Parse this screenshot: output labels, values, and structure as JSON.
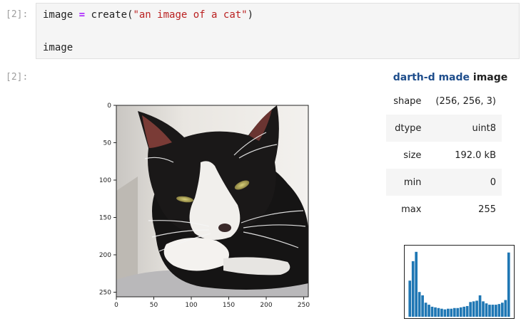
{
  "input_cell": {
    "prompt": "[2]:",
    "line1": {
      "var": "image ",
      "op": "=",
      "func": " create(",
      "str": "\"an image of a cat\"",
      "close": ")"
    },
    "line2": "image"
  },
  "output_cell": {
    "prompt": "[2]:",
    "title_pkg": "darth-d made",
    "title_rest": " image",
    "info_rows": [
      {
        "key": "shape",
        "value": "(256, 256, 3)"
      },
      {
        "key": "dtype",
        "value": "uint8"
      },
      {
        "key": "size",
        "value": "192.0 kB"
      },
      {
        "key": "min",
        "value": "0"
      },
      {
        "key": "max",
        "value": "255"
      }
    ]
  },
  "image_plot": {
    "subject": "black-and-white cat lying down",
    "xticks": [
      "0",
      "50",
      "100",
      "150",
      "200",
      "250"
    ],
    "yticks": [
      "0",
      "50",
      "100",
      "150",
      "200",
      "250"
    ]
  },
  "histogram": {
    "color": "#1f77b4",
    "bin_fractions": [
      0.54,
      0.83,
      0.97,
      0.37,
      0.32,
      0.21,
      0.18,
      0.15,
      0.14,
      0.13,
      0.12,
      0.11,
      0.12,
      0.12,
      0.13,
      0.13,
      0.14,
      0.15,
      0.16,
      0.22,
      0.23,
      0.24,
      0.32,
      0.23,
      0.2,
      0.18,
      0.18,
      0.18,
      0.19,
      0.21,
      0.25,
      0.96
    ]
  }
}
